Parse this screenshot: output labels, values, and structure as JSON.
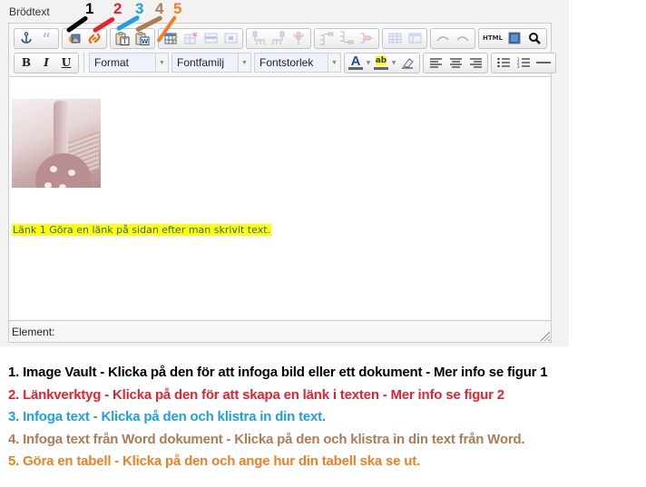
{
  "field": {
    "label": "Brödtext"
  },
  "toolbar": {
    "row1": [
      {
        "icon": "anchor-icon",
        "label": "Ankare"
      },
      {
        "icon": "blockquote-icon",
        "label": "Citat",
        "disabled": true
      },
      {
        "icon": "image-vault-icon",
        "label": "Image Vault"
      },
      {
        "icon": "link-tool-icon",
        "label": "Länkverktyg"
      },
      {
        "icon": "paste-text-icon",
        "label": "Infoga text"
      },
      {
        "icon": "paste-word-icon",
        "label": "Infoga text från Word"
      },
      {
        "icon": "insert-table-icon",
        "label": "Tabell"
      },
      {
        "icon": "delete-table-icon",
        "disabled": true
      },
      {
        "icon": "row-props-icon",
        "disabled": true
      },
      {
        "icon": "cell-props-icon",
        "disabled": true
      },
      {
        "icon": "insert-col-before-icon",
        "disabled": true
      },
      {
        "icon": "insert-col-after-icon",
        "disabled": true
      },
      {
        "icon": "delete-col-icon",
        "disabled": true
      },
      {
        "icon": "insert-row-before-icon",
        "disabled": true
      },
      {
        "icon": "insert-row-after-icon",
        "disabled": true
      },
      {
        "icon": "delete-row-icon",
        "disabled": true
      },
      {
        "icon": "merge-cells-icon",
        "disabled": true
      },
      {
        "icon": "split-cells-icon",
        "disabled": true
      },
      {
        "icon": "undo-icon",
        "disabled": true
      },
      {
        "icon": "redo-icon",
        "disabled": true
      },
      {
        "icon": "html-source-icon",
        "label": "HTML"
      },
      {
        "icon": "fullscreen-icon"
      },
      {
        "icon": "search-icon"
      }
    ],
    "bold_label": "B",
    "italic_label": "I",
    "underline_label": "U",
    "format_select": "Format",
    "font_family_select": "Fontfamilj",
    "font_size_select": "Fontstorlek",
    "text_color_label": "A",
    "highlight_label": "ab"
  },
  "content": {
    "image_alt": "Keramikfigur",
    "link_paragraph": "Länk 1 Göra en länk på sidan efter man skrivit text.",
    "highlight_color": "#ffff00",
    "link_color": "#2b61a8"
  },
  "status": {
    "path_label": "Element:"
  },
  "markers": [
    {
      "num": "1",
      "color": "#000000"
    },
    {
      "num": "2",
      "color": "#e8222d"
    },
    {
      "num": "3",
      "color": "#1ba1e2"
    },
    {
      "num": "4",
      "color": "#b07a55"
    },
    {
      "num": "5",
      "color": "#f27e1f"
    }
  ],
  "notes": [
    {
      "text": "1. Image Vault  - Klicka på den för att infoga bild eller ett dokument  -  Mer info se figur 1",
      "color": "#000000"
    },
    {
      "text": "2. Länkverktyg - Klicka på den för att skapa en länk i texten -  Mer info se figur 2",
      "color": "#e8222d"
    },
    {
      "text": "3. Infoga text - Klicka på den och klistra in din text.",
      "color": "#1ba1e2"
    },
    {
      "text": "4. Infoga text från Word dokument - Klicka på den och klistra in din text från Word.",
      "color": "#b07a55"
    },
    {
      "text": "5. Göra en tabell - Klicka på den och ange hur din tabell ska se ut.",
      "color": "#f27e1f"
    }
  ]
}
